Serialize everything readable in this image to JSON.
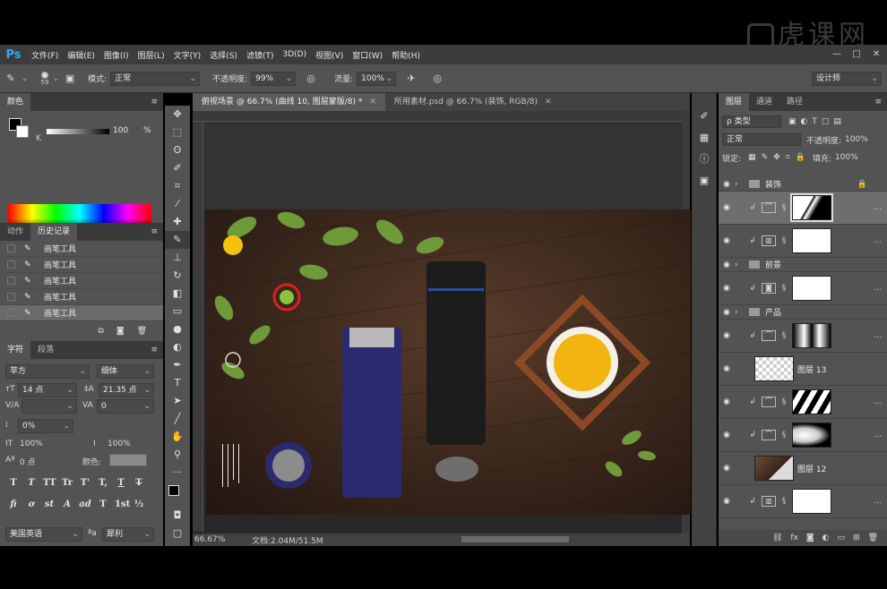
{
  "menubar": {
    "logo": "Ps",
    "items": [
      "文件(F)",
      "编辑(E)",
      "图像(I)",
      "图层(L)",
      "文字(Y)",
      "选择(S)",
      "滤镜(T)",
      "3D(D)",
      "视图(V)",
      "窗口(W)",
      "帮助(H)"
    ],
    "minimize": "—",
    "maximize": "□",
    "close": "✕"
  },
  "watermark": "虎课网",
  "options": {
    "brush_size": "59",
    "mode_label": "模式:",
    "mode_value": "正常",
    "opacity_label": "不透明度:",
    "opacity_value": "99%",
    "flow_label": "流量:",
    "flow_value": "100%",
    "workspace": "设计师"
  },
  "color_panel": {
    "tab": "颜色",
    "channel": "K",
    "value": "100",
    "unit": "%"
  },
  "history_panel": {
    "tabs": [
      "动作",
      "历史记录"
    ],
    "items": [
      "画笔工具",
      "画笔工具",
      "画笔工具",
      "画笔工具",
      "画笔工具"
    ]
  },
  "character_panel": {
    "tabs": [
      "字符",
      "段落"
    ],
    "font_family": "苹方",
    "font_style": "细体",
    "font_size": "14 点",
    "leading": "21.35 点",
    "kerning": "",
    "tracking": "0",
    "tsume": "0%",
    "vscale": "100%",
    "hscale": "100%",
    "baseline": "0 点",
    "color_label": "颜色:",
    "styles": [
      "T",
      "T",
      "TT",
      "Tr",
      "T'",
      "T,",
      "T",
      "T"
    ],
    "opentype": [
      "fi",
      "ơ",
      "st",
      "A",
      "ad",
      "T",
      "1st",
      "½"
    ],
    "language": "美国英语",
    "aa": "犀利"
  },
  "document": {
    "tabs": [
      {
        "title": "俯视场景 @ 66.7% (曲线 10, 图层蒙版/8) *",
        "close": "✕"
      },
      {
        "title": "所用素材.psd @ 66.7% (装饰, RGB/8)",
        "close": "✕"
      }
    ],
    "zoom": "66.67%",
    "doc_size": "文档:2.04M/51.5M"
  },
  "layers_panel": {
    "tabs": [
      "图层",
      "通道",
      "路径"
    ],
    "filter_label": "ρ 类型",
    "blend_mode": "正常",
    "opacity_label": "不透明度:",
    "opacity_value": "100%",
    "lock_label": "锁定:",
    "fill_label": "填充:",
    "fill_value": "100%",
    "layers": [
      {
        "name": "装饰",
        "kind": "group"
      },
      {
        "name": "",
        "kind": "curves-mask",
        "selected": true
      },
      {
        "name": "",
        "kind": "levels"
      },
      {
        "name": "前景",
        "kind": "group"
      },
      {
        "name": "",
        "kind": "camera"
      },
      {
        "name": "产品",
        "kind": "group"
      },
      {
        "name": "",
        "kind": "curves-dark"
      },
      {
        "name": "图层 13",
        "kind": "pixel"
      },
      {
        "name": "",
        "kind": "curves-stripes"
      },
      {
        "name": "",
        "kind": "curves-blur"
      },
      {
        "name": "图层 12",
        "kind": "pixel-wood"
      },
      {
        "name": "",
        "kind": "levels"
      }
    ]
  }
}
